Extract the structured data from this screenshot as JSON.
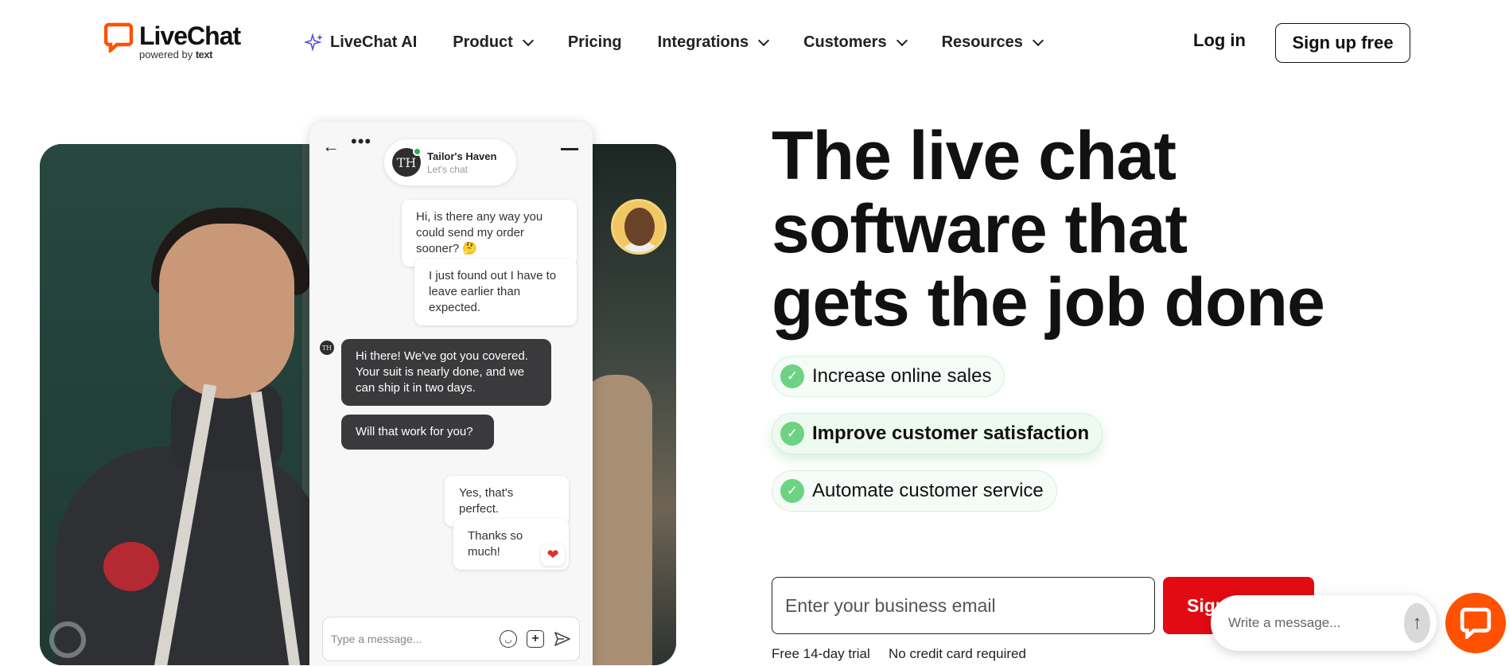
{
  "brand": {
    "name": "LiveChat",
    "powered_by": "powered by",
    "parent": "text",
    "accent": "#ff5100"
  },
  "nav": {
    "items": [
      {
        "label": "LiveChat AI",
        "icon": "sparkle-icon"
      },
      {
        "label": "Product",
        "icon": "chevron-down-icon"
      },
      {
        "label": "Pricing"
      },
      {
        "label": "Integrations",
        "icon": "chevron-down-icon"
      },
      {
        "label": "Customers",
        "icon": "chevron-down-icon"
      },
      {
        "label": "Resources",
        "icon": "chevron-down-icon"
      }
    ],
    "login": "Log in",
    "signup": "Sign up free"
  },
  "widget": {
    "agent_name": "Tailor's Haven",
    "agent_initials": "TH",
    "agent_status": "Let's chat",
    "messages": [
      {
        "from": "customer",
        "text": "Hi, is there any way you could send my order sooner? 🤔"
      },
      {
        "from": "customer",
        "text": "I just found out I have to leave earlier than expected."
      },
      {
        "from": "agent",
        "text": "Hi there! We've got you covered. Your suit is nearly done, and we can ship it in two days."
      },
      {
        "from": "agent",
        "text": "Will that work for you?"
      },
      {
        "from": "customer",
        "text": "Yes, that's perfect."
      },
      {
        "from": "customer",
        "text": "Thanks so much!"
      }
    ],
    "reaction": "❤",
    "composer_placeholder": "Type a message..."
  },
  "hero": {
    "headline_lines": [
      "The live chat",
      "software that",
      "gets the job done"
    ],
    "benefits": [
      {
        "label": "Increase online sales",
        "active": false
      },
      {
        "label": "Improve customer satisfaction",
        "active": true
      },
      {
        "label": "Automate customer service",
        "active": false
      }
    ],
    "email_placeholder": "Enter your business email",
    "cta_label": "Sign",
    "notes": [
      "Free 14-day trial",
      "No credit card required"
    ],
    "cta_color": "#e30b13"
  },
  "chat_launcher": {
    "placeholder": "Write a message..."
  }
}
